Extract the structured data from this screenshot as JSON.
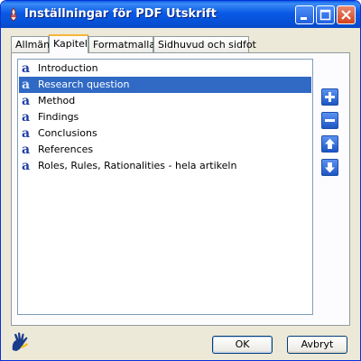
{
  "window": {
    "title": "Inställningar för PDF Utskrift"
  },
  "tabs": [
    {
      "label": "Allmänt",
      "active": false
    },
    {
      "label": "Kapitel",
      "active": true
    },
    {
      "label": "Formatmallar",
      "active": false
    },
    {
      "label": "Sidhuvud och sidfot",
      "active": false
    }
  ],
  "chapters": {
    "items": [
      {
        "label": "Introduction",
        "selected": false
      },
      {
        "label": "Research question",
        "selected": true
      },
      {
        "label": "Method",
        "selected": false
      },
      {
        "label": "Findings",
        "selected": false
      },
      {
        "label": "Conclusions",
        "selected": false
      },
      {
        "label": "References",
        "selected": false
      },
      {
        "label": "Roles, Rules, Rationalities - hela artikeln",
        "selected": false
      }
    ],
    "item_icon": "document-style-icon",
    "item_icon_glyph": "a"
  },
  "side_buttons": [
    {
      "name": "add-icon"
    },
    {
      "name": "remove-icon"
    },
    {
      "name": "move-up-icon"
    },
    {
      "name": "move-down-icon"
    }
  ],
  "footer": {
    "ok_label": "OK",
    "cancel_label": "Avbryt"
  },
  "colors": {
    "titlebar": "#0a5ae6",
    "selection": "#316ac5",
    "dialog_bg": "#ece9d8",
    "active_tab_accent": "#f8b636"
  }
}
